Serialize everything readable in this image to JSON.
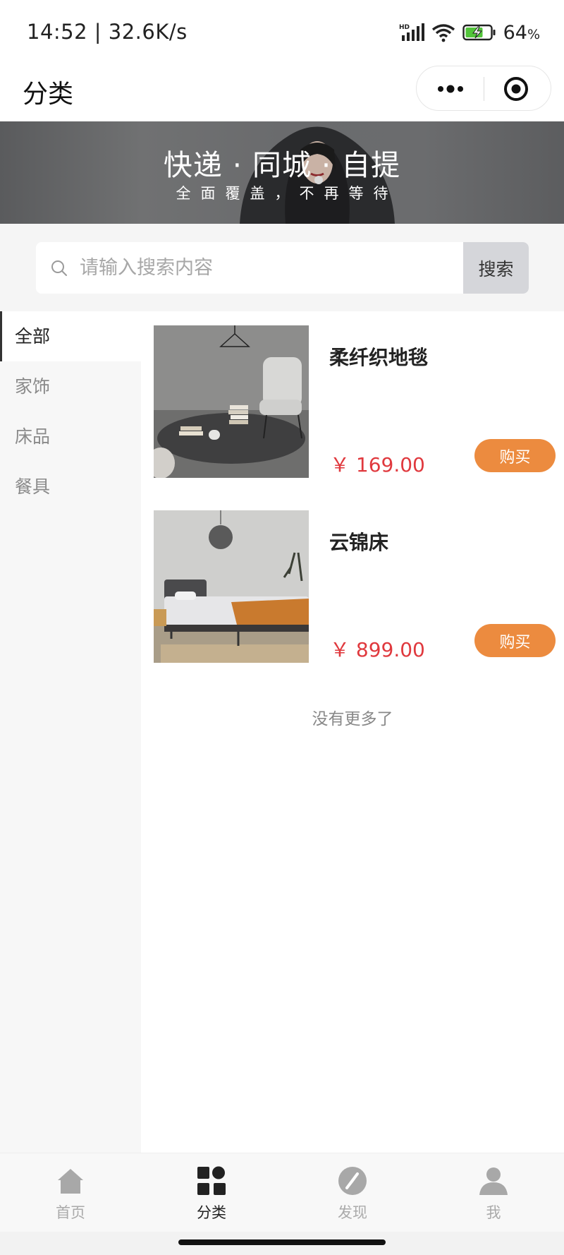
{
  "status_bar": {
    "time_speed": "14:52 | 32.6K/s",
    "battery_percent": "64",
    "battery_unit": "%",
    "icons": [
      "hd-signal-icon",
      "wifi-icon",
      "battery-charging-icon"
    ]
  },
  "nav": {
    "title": "分类",
    "icons": [
      "more-dots-icon",
      "target-close-icon"
    ]
  },
  "banner": {
    "title": "快递 · 同城 · 自提",
    "subtitle": "全面覆盖，不再等待"
  },
  "search": {
    "placeholder": "请输入搜索内容",
    "value": "",
    "button_label": "搜索"
  },
  "sidebar": {
    "active_index": 0,
    "items": [
      {
        "label": "全部"
      },
      {
        "label": "家饰"
      },
      {
        "label": "床品"
      },
      {
        "label": "餐具"
      }
    ]
  },
  "products": [
    {
      "name": "柔纤织地毯",
      "price": "￥ 169.00",
      "buy_label": "购买",
      "image": "rug-room-photo"
    },
    {
      "name": "云锦床",
      "price": "￥ 899.00",
      "buy_label": "购买",
      "image": "bed-room-photo"
    }
  ],
  "list_footer": "没有更多了",
  "tab_bar": {
    "active_index": 1,
    "tabs": [
      {
        "label": "首页",
        "icon": "home-icon"
      },
      {
        "label": "分类",
        "icon": "category-grid-icon"
      },
      {
        "label": "发现",
        "icon": "compass-icon"
      },
      {
        "label": "我",
        "icon": "user-icon"
      }
    ]
  },
  "colors": {
    "accent_orange": "#ec8b3f",
    "price_red": "#e0393e",
    "search_button_bg": "#d5d6da",
    "sidebar_bg": "#f7f7f7"
  }
}
